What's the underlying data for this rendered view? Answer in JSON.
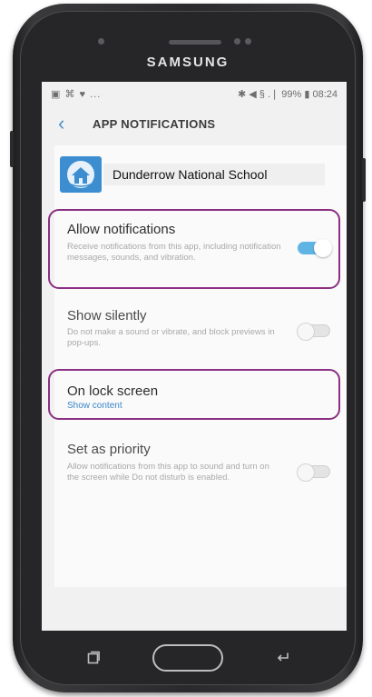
{
  "device": {
    "brand": "SAMSUNG"
  },
  "status_bar": {
    "left_icons": "▣ ⌘ ♥ ...",
    "right_text": "✱ ◀ § .❘ 99% ▮ 08:24"
  },
  "header": {
    "back_icon": "chevron-left-icon",
    "title": "APP NOTIFICATIONS"
  },
  "app": {
    "name": "Dunderrow National School",
    "icon": "school-icon"
  },
  "settings": [
    {
      "title": "Allow notifications",
      "description": "Receive notifications from this app, including notification messages, sounds, and vibration.",
      "toggle_on": true
    },
    {
      "title": "Show silently",
      "description": "Do not make a sound or vibrate, and block previews in pop-ups.",
      "toggle_on": false
    },
    {
      "title": "On lock screen",
      "subtitle": "Show content"
    },
    {
      "title": "Set as priority",
      "description": "Allow notifications from this app to sound and turn on the screen while Do not disturb is enabled.",
      "toggle_on": false
    }
  ],
  "colors": {
    "accent": "#5fb4e4",
    "highlight": "#8a2f82",
    "link": "#3a86c8"
  }
}
